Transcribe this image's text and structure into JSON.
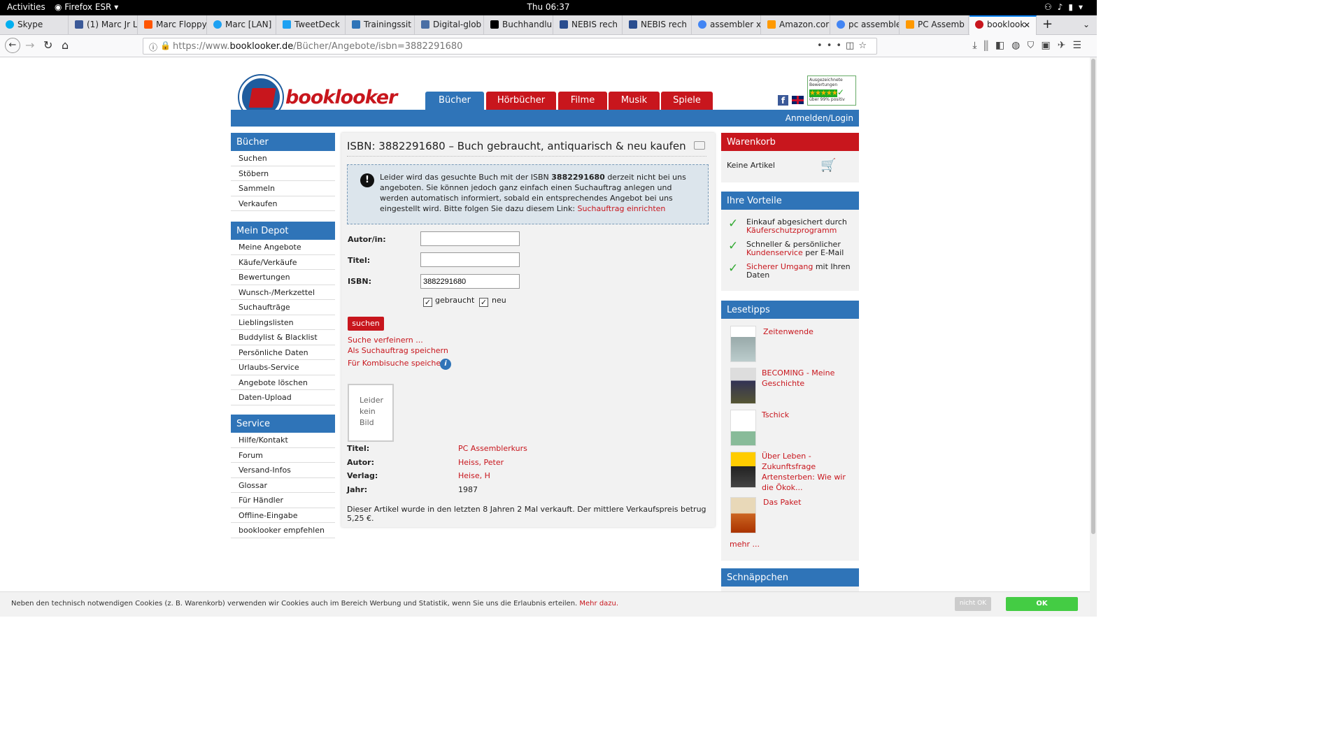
{
  "system": {
    "activities": "Activities",
    "app": "Firefox ESR",
    "clock": "Thu 06:37"
  },
  "browser": {
    "tabs": [
      {
        "label": "Skype",
        "color": "#00aff0"
      },
      {
        "label": "(1) Marc Jr L",
        "color": "#3b5998"
      },
      {
        "label": "Marc Floppy",
        "color": "#ff5500"
      },
      {
        "label": "Marc [LAN]",
        "color": "#1da1f2"
      },
      {
        "label": "TweetDeck",
        "color": "#1da1f2"
      },
      {
        "label": "Trainingssit",
        "color": "#2f74b8"
      },
      {
        "label": "Digital-glob",
        "color": "#4a6fa5"
      },
      {
        "label": "Buchhandlu",
        "color": "#000000"
      },
      {
        "label": "NEBIS rech",
        "color": "#2a4d8f"
      },
      {
        "label": "NEBIS rech",
        "color": "#2a4d8f"
      },
      {
        "label": "assembler x",
        "color": "#4285f4"
      },
      {
        "label": "Amazon.cor",
        "color": "#ff9900"
      },
      {
        "label": "pc assemble",
        "color": "#4285f4"
      },
      {
        "label": "PC Assemb",
        "color": "#ff9900"
      },
      {
        "label": "booklook",
        "color": "#c8161d"
      }
    ],
    "url_prefix": "https://www.",
    "url_domain": "booklooker.de",
    "url_path": "/Bücher/Angebote/isbn=3882291680"
  },
  "site": {
    "brand": "booklooker",
    "nav": [
      "Bücher",
      "Hörbücher",
      "Filme",
      "Musik",
      "Spiele"
    ],
    "login": "Anmelden/Login",
    "badge_line1": "Ausgezeichnete",
    "badge_line2": "Bewertungen",
    "badge_line3": "über 99% positiv"
  },
  "sidebar": {
    "buecher": {
      "title": "Bücher",
      "items": [
        "Suchen",
        "Stöbern",
        "Sammeln",
        "Verkaufen"
      ]
    },
    "depot": {
      "title": "Mein Depot",
      "items": [
        "Meine Angebote",
        "Käufe/Verkäufe",
        "Bewertungen",
        "Wunsch-/Merkzettel",
        "Suchaufträge",
        "Lieblingslisten",
        "Buddylist & Blacklist",
        "Persönliche Daten",
        "Urlaubs-Service",
        "Angebote löschen",
        "Daten-Upload"
      ]
    },
    "service": {
      "title": "Service",
      "items": [
        "Hilfe/Kontakt",
        "Forum",
        "Versand-Infos",
        "Glossar",
        "Für Händler",
        "Offline-Eingabe",
        "booklooker empfehlen"
      ]
    }
  },
  "main": {
    "heading": "ISBN: 3882291680 – Buch gebraucht, antiquarisch & neu kaufen",
    "notice_pre": "Leider wird das gesuchte Buch mit der ISBN ",
    "notice_isbn": "3882291680",
    "notice_post": " derzeit nicht bei uns angeboten. Sie können jedoch ganz einfach einen Suchauftrag anlegen und werden automatisch informiert, sobald ein entsprechendes Angebot bei uns eingestellt wird. Bitte folgen Sie dazu diesem Link: ",
    "notice_link": "Suchauftrag einrichten",
    "form": {
      "author_label": "Autor/in:",
      "author_value": "",
      "title_label": "Titel:",
      "title_value": "",
      "isbn_label": "ISBN:",
      "isbn_value": "3882291680",
      "used_label": "gebraucht",
      "used_checked": true,
      "new_label": "neu",
      "new_checked": true,
      "submit": "suchen"
    },
    "links": [
      "Suche verfeinern ...",
      "Als Suchauftrag speichern",
      "Für Kombisuche speichern"
    ],
    "no_image": [
      "Leider",
      "kein",
      "Bild"
    ],
    "details": [
      {
        "label": "Titel:",
        "value": "PC Assemblerkurs",
        "link": true
      },
      {
        "label": "Autor:",
        "value": "Heiss, Peter",
        "link": true
      },
      {
        "label": "Verlag:",
        "value": "Heise, H",
        "link": true
      },
      {
        "label": "Jahr:",
        "value": "1987",
        "link": false
      }
    ],
    "sold_note": "Dieser Artikel wurde in den letzten 8 Jahren 2 Mal verkauft. Der mittlere Verkaufspreis betrug 5,25 €."
  },
  "right": {
    "cart_title": "Warenkorb",
    "cart_empty": "Keine Artikel",
    "advantages_title": "Ihre Vorteile",
    "advantages": [
      {
        "pre": "Einkauf abgesichert durch ",
        "link": "Käuferschutzprogramm",
        "post": ""
      },
      {
        "pre": "Schneller & persönlicher ",
        "link": "Kundenservice",
        "post": " per E-Mail"
      },
      {
        "pre": "",
        "link": "Sicherer Umgang",
        "post": " mit Ihren Daten"
      }
    ],
    "tips_title": "Lesetipps",
    "tips": [
      "Zeitenwende",
      "BECOMING - Meine Geschichte",
      "Tschick",
      "Über Leben - Zukunftsfrage Artensterben: Wie wir die Ökok...",
      "Das Paket"
    ],
    "more": "mehr ...",
    "bargains_title": "Schnäppchen"
  },
  "cookie": {
    "text": "Neben den technisch notwendigen Cookies (z. B. Warenkorb) verwenden wir Cookies auch im Bereich Werbung und Statistik, wenn Sie uns die Erlaubnis erteilen.",
    "more": "Mehr dazu.",
    "decline": "nicht OK",
    "accept": "OK"
  }
}
